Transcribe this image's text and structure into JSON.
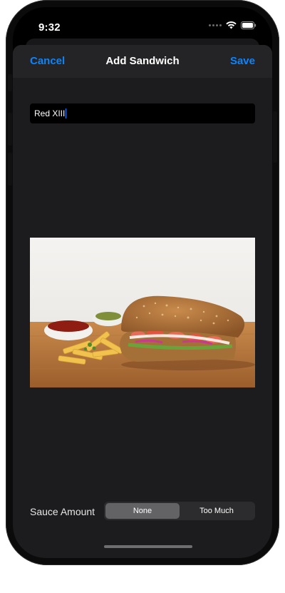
{
  "status_bar": {
    "time": "9:32",
    "icons": [
      "signal-dots-icon",
      "wifi-icon",
      "battery-icon"
    ]
  },
  "navigation": {
    "cancel_label": "Cancel",
    "title": "Add Sandwich",
    "save_label": "Save"
  },
  "name_field": {
    "value": "Red XIII"
  },
  "photo": {
    "description_icon": "sandwich-photo"
  },
  "sauce": {
    "label": "Sauce Amount",
    "options": [
      "None",
      "Too Much"
    ],
    "selected": "None"
  },
  "colors": {
    "accent": "#0a84ff",
    "modal_background": "#1c1c1e",
    "nav_background": "#242426",
    "segment_selected": "#636366"
  }
}
